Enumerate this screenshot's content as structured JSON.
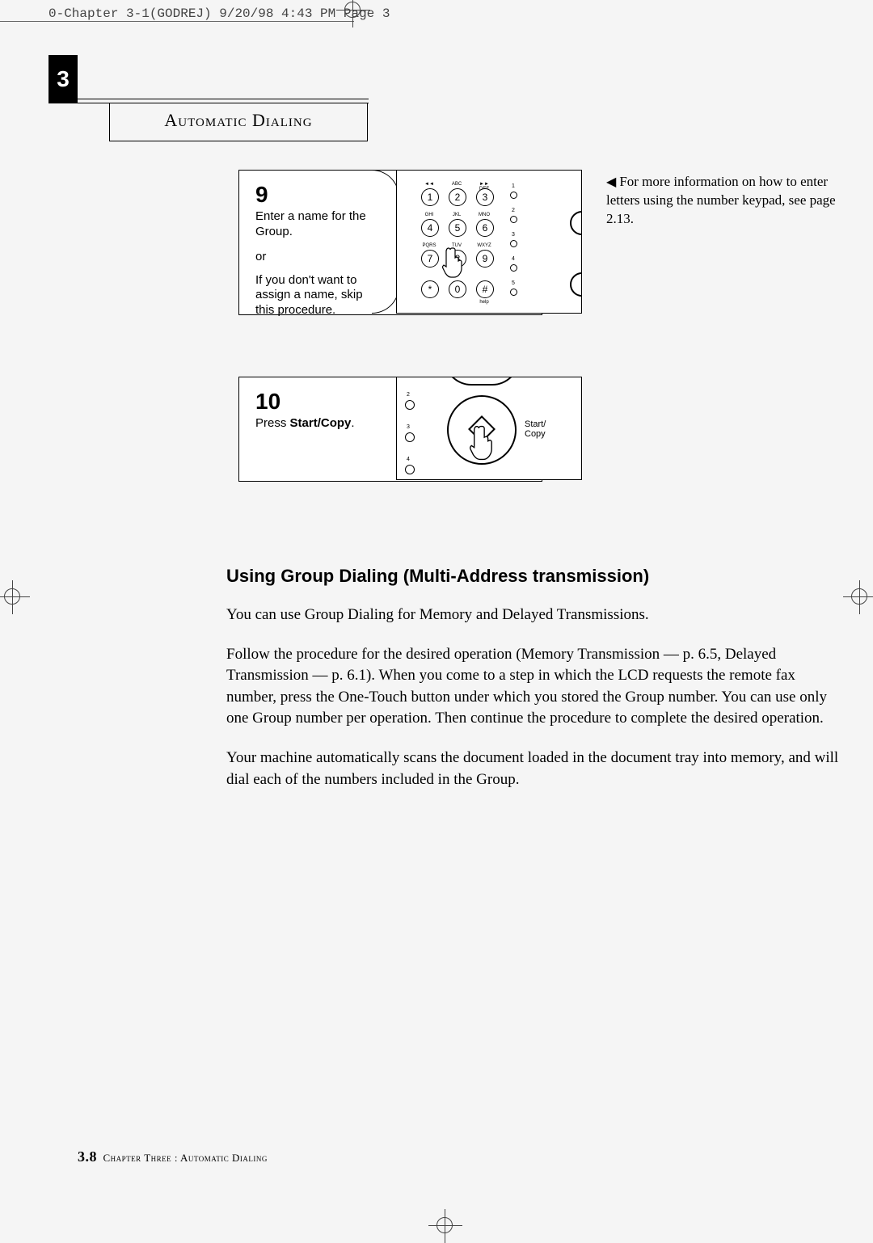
{
  "slug": "0-Chapter 3-1(GODREJ)  9/20/98 4:43 PM  Page 3",
  "chapter_tab": "3",
  "header_title": "Automatic Dialing",
  "step9": {
    "num": "9",
    "desc": "Enter a name for the Group.",
    "or": "or",
    "alt": "If you don't want to assign a name, skip this procedure."
  },
  "keypad": {
    "keys": [
      "1",
      "2",
      "3",
      "4",
      "5",
      "6",
      "7",
      "8",
      "9",
      "*",
      "0",
      "#"
    ],
    "labels_row1": [
      "◄◄",
      "ABC",
      "►► DEF"
    ],
    "labels_row2": [
      "GHI",
      "JKL",
      "MNO"
    ],
    "labels_row3": [
      "PQRS",
      "TUV",
      "WXYZ"
    ],
    "help_label": "help",
    "side_nums": [
      "1",
      "2",
      "3",
      "4",
      "5"
    ]
  },
  "step10": {
    "num": "10",
    "desc_prefix": "Press ",
    "desc_bold": "Start/Copy",
    "desc_suffix": "."
  },
  "startcopy_panel": {
    "label": "Start/\nCopy",
    "side_nums": [
      "2",
      "3",
      "4"
    ]
  },
  "side_note": "For more information on how to enter letters using the number keypad, see page 2.13.",
  "h2": "Using Group Dialing (Multi-Address transmission)",
  "para1": "You can use Group Dialing for Memory and Delayed Transmissions.",
  "para2": "Follow the procedure for the desired operation (Memory Transmission — p. 6.5, Delayed Transmission — p. 6.1). When you come to a step in which the LCD requests the remote fax number, press the One-Touch button under which you stored the Group number. You can use only one Group number per operation. Then continue the procedure to complete the desired operation.",
  "para3": "Your machine automatically scans the document loaded in the document tray into memory, and will dial each of the numbers included in the Group.",
  "footer_page": "3.8",
  "footer_text": "Chapter Three : Automatic Dialing"
}
